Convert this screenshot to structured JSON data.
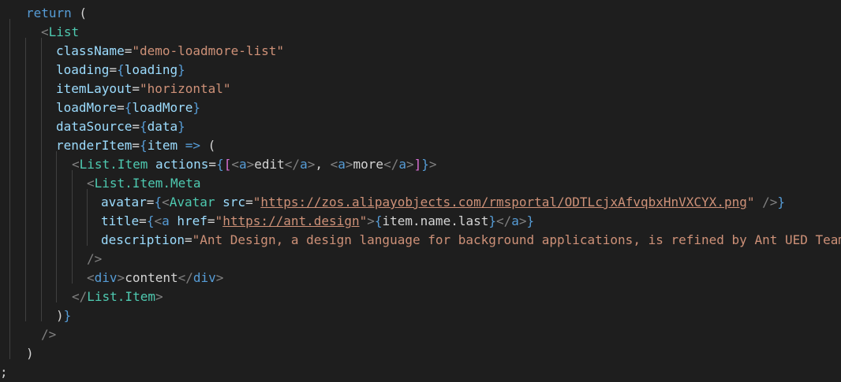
{
  "editor": {
    "language": "jsx",
    "lines": [
      [
        {
          "t": "return",
          "c": "kw"
        },
        {
          "t": " (",
          "c": "p"
        }
      ],
      [
        {
          "t": "<",
          "c": "br"
        },
        {
          "t": "List",
          "c": "tag"
        }
      ],
      [
        {
          "t": "className",
          "c": "attr"
        },
        {
          "t": "=",
          "c": "p"
        },
        {
          "t": "\"demo-loadmore-list\"",
          "c": "str"
        }
      ],
      [
        {
          "t": "loading",
          "c": "attr"
        },
        {
          "t": "=",
          "c": "p"
        },
        {
          "t": "{",
          "c": "brace"
        },
        {
          "t": "loading",
          "c": "var"
        },
        {
          "t": "}",
          "c": "brace"
        }
      ],
      [
        {
          "t": "itemLayout",
          "c": "attr"
        },
        {
          "t": "=",
          "c": "p"
        },
        {
          "t": "\"horizontal\"",
          "c": "str"
        }
      ],
      [
        {
          "t": "loadMore",
          "c": "attr"
        },
        {
          "t": "=",
          "c": "p"
        },
        {
          "t": "{",
          "c": "brace"
        },
        {
          "t": "loadMore",
          "c": "var"
        },
        {
          "t": "}",
          "c": "brace"
        }
      ],
      [
        {
          "t": "dataSource",
          "c": "attr"
        },
        {
          "t": "=",
          "c": "p"
        },
        {
          "t": "{",
          "c": "brace"
        },
        {
          "t": "data",
          "c": "var"
        },
        {
          "t": "}",
          "c": "brace"
        }
      ],
      [
        {
          "t": "renderItem",
          "c": "attr"
        },
        {
          "t": "=",
          "c": "p"
        },
        {
          "t": "{",
          "c": "brace"
        },
        {
          "t": "item",
          "c": "var"
        },
        {
          "t": " ",
          "c": "p"
        },
        {
          "t": "=>",
          "c": "op"
        },
        {
          "t": " (",
          "c": "p"
        }
      ],
      [
        {
          "t": "<",
          "c": "br"
        },
        {
          "t": "List.Item",
          "c": "tag"
        },
        {
          "t": " ",
          "c": "p"
        },
        {
          "t": "actions",
          "c": "attr"
        },
        {
          "t": "=",
          "c": "p"
        },
        {
          "t": "{",
          "c": "brace"
        },
        {
          "t": "[",
          "c": "pink"
        },
        {
          "t": "<",
          "c": "br"
        },
        {
          "t": "a",
          "c": "html"
        },
        {
          "t": ">",
          "c": "br"
        },
        {
          "t": "edit",
          "c": "txt"
        },
        {
          "t": "</",
          "c": "br"
        },
        {
          "t": "a",
          "c": "html"
        },
        {
          "t": ">",
          "c": "br"
        },
        {
          "t": ", ",
          "c": "p"
        },
        {
          "t": "<",
          "c": "br"
        },
        {
          "t": "a",
          "c": "html"
        },
        {
          "t": ">",
          "c": "br"
        },
        {
          "t": "more",
          "c": "txt"
        },
        {
          "t": "</",
          "c": "br"
        },
        {
          "t": "a",
          "c": "html"
        },
        {
          "t": ">",
          "c": "br"
        },
        {
          "t": "]",
          "c": "pink"
        },
        {
          "t": "}",
          "c": "brace"
        },
        {
          "t": ">",
          "c": "br"
        }
      ],
      [
        {
          "t": "<",
          "c": "br"
        },
        {
          "t": "List.Item.Meta",
          "c": "tag"
        }
      ],
      [
        {
          "t": "avatar",
          "c": "attr"
        },
        {
          "t": "=",
          "c": "p"
        },
        {
          "t": "{",
          "c": "brace"
        },
        {
          "t": "<",
          "c": "br"
        },
        {
          "t": "Avatar",
          "c": "tag"
        },
        {
          "t": " ",
          "c": "p"
        },
        {
          "t": "src",
          "c": "attr"
        },
        {
          "t": "=",
          "c": "p"
        },
        {
          "t": "\"",
          "c": "str"
        },
        {
          "t": "https://zos.alipayobjects.com/rmsportal/ODTLcjxAfvqbxHnVXCYX.png",
          "c": "url"
        },
        {
          "t": "\"",
          "c": "str"
        },
        {
          "t": " ",
          "c": "p"
        },
        {
          "t": "/>",
          "c": "br"
        },
        {
          "t": "}",
          "c": "brace"
        }
      ],
      [
        {
          "t": "title",
          "c": "attr"
        },
        {
          "t": "=",
          "c": "p"
        },
        {
          "t": "{",
          "c": "brace"
        },
        {
          "t": "<",
          "c": "br"
        },
        {
          "t": "a",
          "c": "html"
        },
        {
          "t": " ",
          "c": "p"
        },
        {
          "t": "href",
          "c": "attr"
        },
        {
          "t": "=",
          "c": "p"
        },
        {
          "t": "\"",
          "c": "str"
        },
        {
          "t": "https://ant.design",
          "c": "url"
        },
        {
          "t": "\"",
          "c": "str"
        },
        {
          "t": ">",
          "c": "br"
        },
        {
          "t": "{",
          "c": "brace"
        },
        {
          "t": "item.name.last",
          "c": "txt"
        },
        {
          "t": "}",
          "c": "brace"
        },
        {
          "t": "</",
          "c": "br"
        },
        {
          "t": "a",
          "c": "html"
        },
        {
          "t": ">",
          "c": "br"
        },
        {
          "t": "}",
          "c": "brace"
        }
      ],
      [
        {
          "t": "description",
          "c": "attr"
        },
        {
          "t": "=",
          "c": "p"
        },
        {
          "t": "\"Ant Design, a design language for background applications, is refined by Ant UED Team\"",
          "c": "str"
        }
      ],
      [
        {
          "t": "/>",
          "c": "br"
        }
      ],
      [
        {
          "t": "<",
          "c": "br"
        },
        {
          "t": "div",
          "c": "html"
        },
        {
          "t": ">",
          "c": "br"
        },
        {
          "t": "content",
          "c": "txt"
        },
        {
          "t": "</",
          "c": "br"
        },
        {
          "t": "div",
          "c": "html"
        },
        {
          "t": ">",
          "c": "br"
        }
      ],
      [
        {
          "t": "</",
          "c": "br"
        },
        {
          "t": "List.Item",
          "c": "tag"
        },
        {
          "t": ">",
          "c": "br"
        }
      ],
      [
        {
          "t": ")",
          "c": "p"
        },
        {
          "t": "}",
          "c": "brace"
        }
      ],
      [
        {
          "t": "/>",
          "c": "br"
        }
      ],
      [
        {
          "t": ")",
          "c": "p"
        }
      ],
      [
        {
          "t": ";",
          "c": "p"
        }
      ]
    ]
  }
}
